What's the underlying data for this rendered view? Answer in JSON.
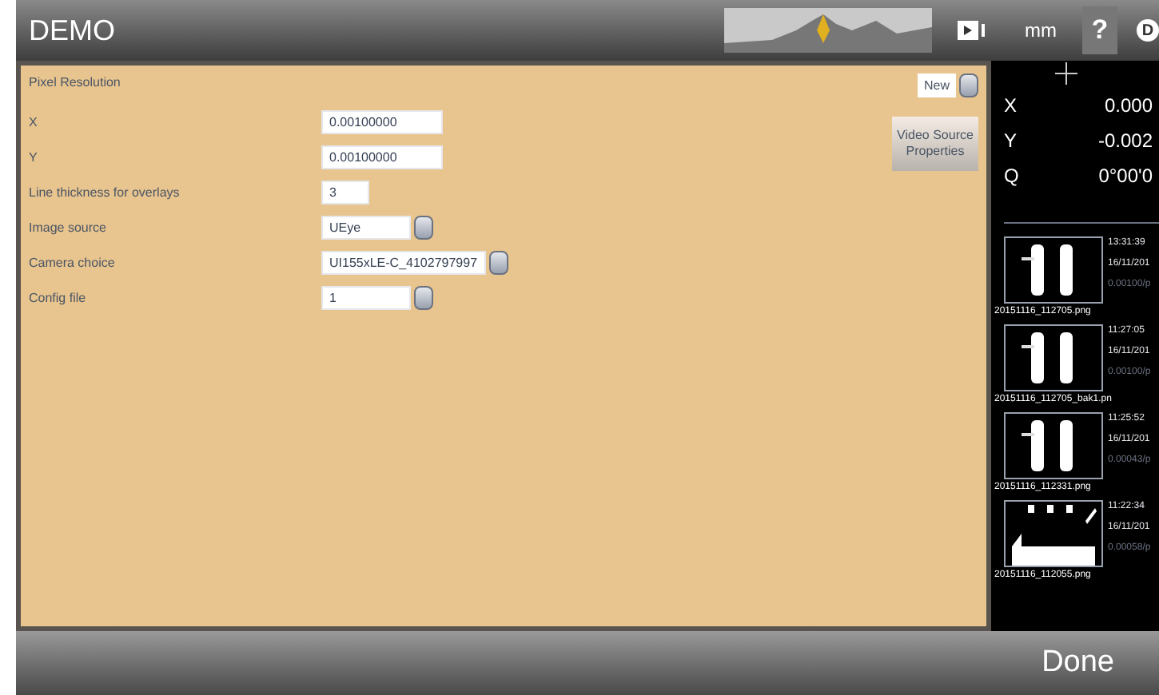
{
  "window": {
    "title": "DEMO"
  },
  "header": {
    "units": "mm",
    "help": "?",
    "badge": "D"
  },
  "form": {
    "heading": "Pixel Resolution",
    "new_button": "New",
    "video_button": "Video Source Properties",
    "fields": [
      {
        "label": "X",
        "kind": "text",
        "value": "0.00100000"
      },
      {
        "label": "Y",
        "kind": "text",
        "value": "0.00100000"
      },
      {
        "label": "Line thickness for overlays",
        "kind": "short",
        "value": "3"
      },
      {
        "label": "Image source",
        "kind": "select",
        "value": "UEye"
      },
      {
        "label": "Camera choice",
        "kind": "select",
        "value": "UI155xLE-C_4102797997"
      },
      {
        "label": "Config file",
        "kind": "select",
        "value": "1"
      }
    ]
  },
  "readout": [
    {
      "axis": "X",
      "value": "0.000"
    },
    {
      "axis": "Y",
      "value": "-0.002"
    },
    {
      "axis": "Q",
      "value": "0°00'0"
    }
  ],
  "images": [
    {
      "time": "13:31:39",
      "date": "16/11/201",
      "resolution": "0.00100/p",
      "file": "20151116_112705.png",
      "kind": "bars"
    },
    {
      "time": "11:27:05",
      "date": "16/11/201",
      "resolution": "0.00100/p",
      "file": "20151116_112705_bak1.pn",
      "kind": "bars"
    },
    {
      "time": "11:25:52",
      "date": "16/11/201",
      "resolution": "0.00043/p",
      "file": "20151116_112331.png",
      "kind": "bars"
    },
    {
      "time": "11:22:34",
      "date": "16/11/201",
      "resolution": "0.00058/p",
      "file": "20151116_112055.png",
      "kind": "tray"
    }
  ],
  "footer": {
    "done": "Done"
  }
}
